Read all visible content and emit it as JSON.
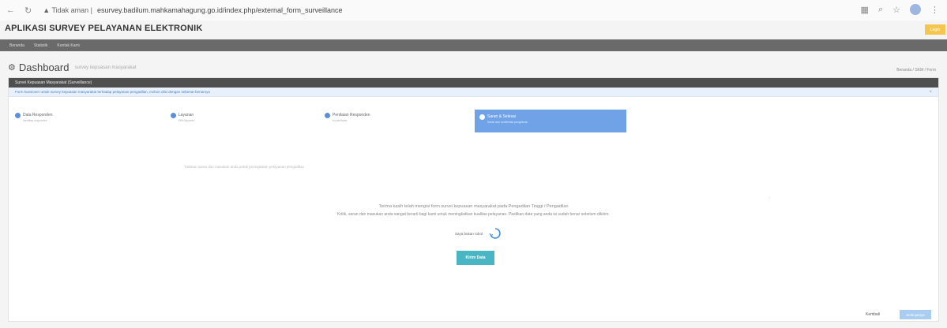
{
  "browser": {
    "warning": "Tidak aman",
    "url": "esurvey.badilum.mahkamahagung.go.id/index.php/external_form_surveillance"
  },
  "app": {
    "title": "APLIKASI SURVEY PELAYANAN ELEKTRONIK",
    "login_label": "Login"
  },
  "menu": {
    "items": [
      "Beranda",
      "Statistik",
      "Kontak Kami"
    ]
  },
  "dashboard": {
    "title": "Dashboard",
    "subtitle": "survey kepuasan masyarakat",
    "breadcrumb": "Beranda / SKM / Form"
  },
  "panel": {
    "header": "Survei Kepuasan Masyarakat (Surveillance)",
    "info": "Form kuesioner untuk survey kepuasan masyarakat terhadap pelayanan pengadilan, mohon diisi dengan sebenar-benarnya"
  },
  "steps": [
    {
      "label": "Data Responden",
      "sub": "Identitas responden"
    },
    {
      "label": "Layanan",
      "sub": "Pilih layanan"
    },
    {
      "label": "Penilaian Responden",
      "sub": "Isi penilaian"
    },
    {
      "label": "Saran & Selesai",
      "sub": "Saran dan konfirmasi pengiriman"
    }
  ],
  "content": {
    "hint": "Tuliskan saran dan masukan anda untuk peningkatan pelayanan pengadilan",
    "thanks_line1": "Terima kasih telah mengisi form survei kepuasan masyarakat pada Pengadilan Tinggi / Pengadilan",
    "thanks_line2": "Kritik, saran dan masukan anda sangat berarti bagi kami untuk meningkatkan kualitas pelayanan. Pastikan data yang anda isi sudah benar sebelum dikirim.",
    "captcha_label": "Saya bukan robot",
    "submit_label": "Kirim Data"
  },
  "footer": {
    "back_label": "Kembali",
    "next_label": "Selanjutnya"
  },
  "colors": {
    "menubar": "#6a6a6a",
    "accent": "#6fa2e6",
    "submit": "#49b6c4",
    "login": "#f3c64f"
  }
}
